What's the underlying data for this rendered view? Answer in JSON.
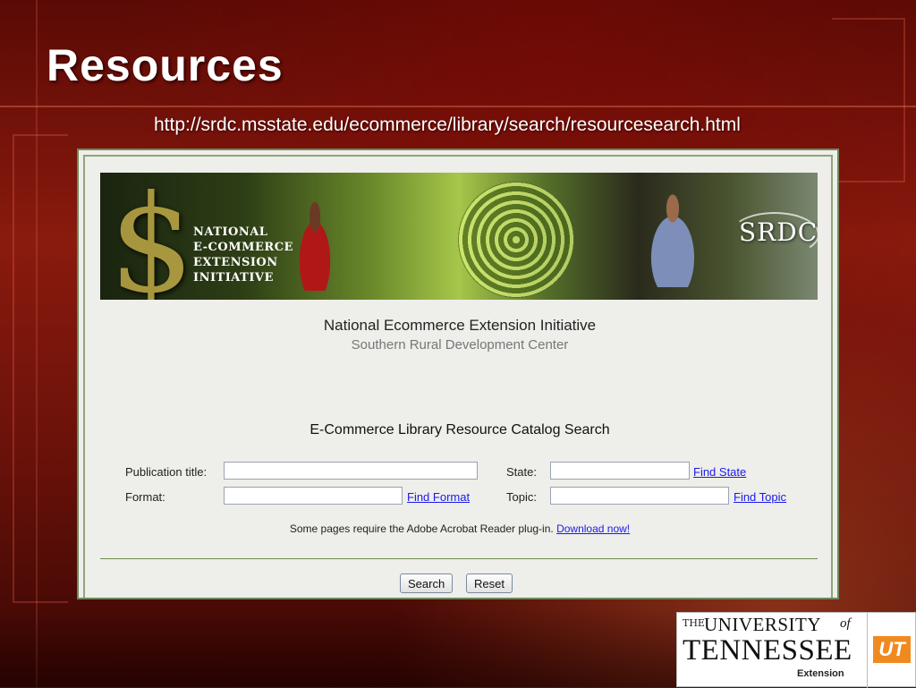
{
  "slide": {
    "title": "Resources",
    "url": "http://srdc.msstate.edu/ecommerce/library/search/resourcesearch.html"
  },
  "banner": {
    "logo_lines": [
      "NATIONAL",
      "E-COMMERCE",
      "EXTENSION",
      "INITIATIVE"
    ],
    "brand": "SRDC"
  },
  "site": {
    "title": "National Ecommerce Extension Initiative",
    "subtitle": "Southern Rural Development Center",
    "search_heading": "E-Commerce Library Resource Catalog Search"
  },
  "form": {
    "publication_title_label": "Publication title:",
    "publication_title_value": "",
    "format_label": "Format:",
    "format_value": "",
    "find_format_link": "Find Format",
    "state_label": "State:",
    "state_value": "",
    "find_state_link": "Find State",
    "topic_label": "Topic:",
    "topic_value": "",
    "find_topic_link": "Find Topic"
  },
  "notice": {
    "text": "Some pages require the Adobe Acrobat Reader plug-in. ",
    "link": "Download now!"
  },
  "buttons": {
    "search": "Search",
    "reset": "Reset"
  },
  "footer_logo": {
    "the": "THE",
    "university": "UNIVERSITY",
    "of": "of",
    "tennessee": "TENNESSEE",
    "extension": "Extension",
    "badge": "UT"
  },
  "colors": {
    "background": "#7a150b",
    "link": "#1a1aee",
    "panel": "#eeeeea",
    "rule": "#6d8a4e",
    "ut_orange": "#f08a20"
  }
}
